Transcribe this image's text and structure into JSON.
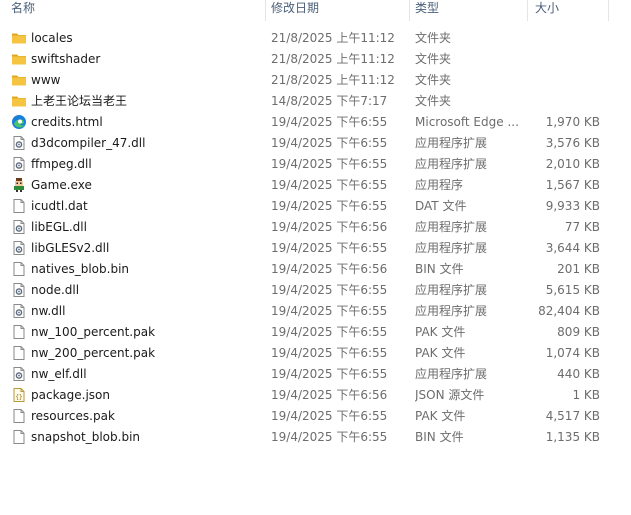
{
  "header": {
    "name": "名称",
    "date": "修改日期",
    "type": "类型",
    "size": "大小"
  },
  "colors": {
    "folder": "#f5c542",
    "folder_dark": "#e0a820",
    "header_text": "#4c607a",
    "meta_text": "#6d6d6d",
    "edge_blue": "#1a7fd6",
    "edge_green": "#4cc26a"
  },
  "files": [
    {
      "name": "locales",
      "date": "21/8/2025 上午11:12",
      "type": "文件夹",
      "size": "",
      "icon": "folder-icon"
    },
    {
      "name": "swiftshader",
      "date": "21/8/2025 上午11:12",
      "type": "文件夹",
      "size": "",
      "icon": "folder-icon"
    },
    {
      "name": "www",
      "date": "21/8/2025 上午11:12",
      "type": "文件夹",
      "size": "",
      "icon": "folder-icon"
    },
    {
      "name": "上老王论坛当老王",
      "date": "14/8/2025 下午7:17",
      "type": "文件夹",
      "size": "",
      "icon": "folder-icon"
    },
    {
      "name": "credits.html",
      "date": "19/4/2025 下午6:55",
      "type": "Microsoft Edge ...",
      "size": "1,970 KB",
      "icon": "edge-icon"
    },
    {
      "name": "d3dcompiler_47.dll",
      "date": "19/4/2025 下午6:55",
      "type": "应用程序扩展",
      "size": "3,576 KB",
      "icon": "dll-icon"
    },
    {
      "name": "ffmpeg.dll",
      "date": "19/4/2025 下午6:55",
      "type": "应用程序扩展",
      "size": "2,010 KB",
      "icon": "dll-icon"
    },
    {
      "name": "Game.exe",
      "date": "19/4/2025 下午6:55",
      "type": "应用程序",
      "size": "1,567 KB",
      "icon": "game-exe-icon"
    },
    {
      "name": "icudtl.dat",
      "date": "19/4/2025 下午6:55",
      "type": "DAT 文件",
      "size": "9,933 KB",
      "icon": "file-icon"
    },
    {
      "name": "libEGL.dll",
      "date": "19/4/2025 下午6:56",
      "type": "应用程序扩展",
      "size": "77 KB",
      "icon": "dll-icon"
    },
    {
      "name": "libGLESv2.dll",
      "date": "19/4/2025 下午6:55",
      "type": "应用程序扩展",
      "size": "3,644 KB",
      "icon": "dll-icon"
    },
    {
      "name": "natives_blob.bin",
      "date": "19/4/2025 下午6:56",
      "type": "BIN 文件",
      "size": "201 KB",
      "icon": "file-icon"
    },
    {
      "name": "node.dll",
      "date": "19/4/2025 下午6:55",
      "type": "应用程序扩展",
      "size": "5,615 KB",
      "icon": "dll-icon"
    },
    {
      "name": "nw.dll",
      "date": "19/4/2025 下午6:55",
      "type": "应用程序扩展",
      "size": "82,404 KB",
      "icon": "dll-icon"
    },
    {
      "name": "nw_100_percent.pak",
      "date": "19/4/2025 下午6:55",
      "type": "PAK 文件",
      "size": "809 KB",
      "icon": "file-icon"
    },
    {
      "name": "nw_200_percent.pak",
      "date": "19/4/2025 下午6:55",
      "type": "PAK 文件",
      "size": "1,074 KB",
      "icon": "file-icon"
    },
    {
      "name": "nw_elf.dll",
      "date": "19/4/2025 下午6:55",
      "type": "应用程序扩展",
      "size": "440 KB",
      "icon": "dll-icon"
    },
    {
      "name": "package.json",
      "date": "19/4/2025 下午6:56",
      "type": "JSON 源文件",
      "size": "1 KB",
      "icon": "json-icon"
    },
    {
      "name": "resources.pak",
      "date": "19/4/2025 下午6:55",
      "type": "PAK 文件",
      "size": "4,517 KB",
      "icon": "file-icon"
    },
    {
      "name": "snapshot_blob.bin",
      "date": "19/4/2025 下午6:55",
      "type": "BIN 文件",
      "size": "1,135 KB",
      "icon": "file-icon"
    }
  ]
}
